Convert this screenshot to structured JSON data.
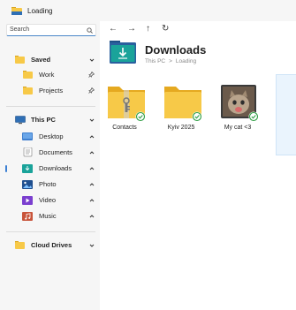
{
  "window": {
    "title": "Loading"
  },
  "sidebar": {
    "search_placeholder": "Search",
    "sections": {
      "saved": "Saved",
      "this_pc": "This PC",
      "cloud_drives": "Cloud Drives"
    },
    "saved_items": [
      {
        "label": "Work",
        "icon": "pin-icon"
      },
      {
        "label": "Projects",
        "icon": "pin-icon"
      }
    ],
    "pc_items": [
      {
        "label": "Desktop"
      },
      {
        "label": "Documents"
      },
      {
        "label": "Downloads",
        "selected": true
      },
      {
        "label": "Photo"
      },
      {
        "label": "Video"
      },
      {
        "label": "Music"
      }
    ]
  },
  "toolbar": {
    "back": "←",
    "forward": "→",
    "up": "↑",
    "refresh": "↻"
  },
  "header": {
    "title": "Downloads",
    "breadcrumb": [
      "This PC",
      "Loading"
    ],
    "breadcrumb_sep": ">"
  },
  "files": [
    {
      "name": "Contacts",
      "type": "zip-folder",
      "status": "synced"
    },
    {
      "name": "Kyiv 2025",
      "type": "folder",
      "status": "synced"
    },
    {
      "name": "My cat <3",
      "type": "image",
      "status": "synced"
    }
  ],
  "colors": {
    "accent": "#3b7fd3",
    "folder": "#f7c948",
    "sync_check": "#2f9e44"
  }
}
